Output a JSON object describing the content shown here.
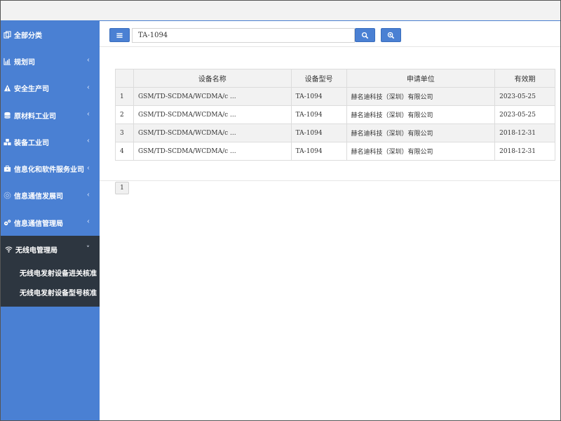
{
  "sidebar": {
    "items": [
      {
        "label": "全部分类",
        "icon": "copy-icon",
        "has_chevron": false
      },
      {
        "label": "规划司",
        "icon": "bar-chart-icon",
        "has_chevron": true
      },
      {
        "label": "安全生产司",
        "icon": "warning-icon",
        "has_chevron": true
      },
      {
        "label": "原材料工业司",
        "icon": "database-icon",
        "has_chevron": true
      },
      {
        "label": "装备工业司",
        "icon": "cubes-icon",
        "has_chevron": true
      },
      {
        "label": "信息化和软件服务业司",
        "icon": "briefcase-icon",
        "has_chevron": true
      },
      {
        "label": "信息通信发展司",
        "icon": "globe-icon",
        "has_chevron": true
      },
      {
        "label": "信息通信管理局",
        "icon": "cogs-icon",
        "has_chevron": true
      }
    ],
    "open_item": {
      "label": "无线电管理局",
      "icon": "wifi-icon",
      "chevron": "˅",
      "sub_items": [
        "无线电发射设备进关核准",
        "无线电发射设备型号核准"
      ]
    },
    "chevron": "‹"
  },
  "search": {
    "value": "TA-1094",
    "menu_icon": "bars-icon",
    "search_icon": "search-icon",
    "zoom_icon": "zoom-in-icon"
  },
  "table": {
    "headers": [
      "",
      "设备名称",
      "设备型号",
      "申请单位",
      "有效期"
    ],
    "rows": [
      {
        "index": "1",
        "name": "GSM/TD-SCDMA/WCDMA/c ...",
        "model": "TA-1094",
        "company": "赫名迪科技（深圳）有限公司",
        "expiry": "2023-05-25"
      },
      {
        "index": "2",
        "name": "GSM/TD-SCDMA/WCDMA/c ...",
        "model": "TA-1094",
        "company": "赫名迪科技（深圳）有限公司",
        "expiry": "2023-05-25"
      },
      {
        "index": "3",
        "name": "GSM/TD-SCDMA/WCDMA/c ...",
        "model": "TA-1094",
        "company": "赫名迪科技（深圳）有限公司",
        "expiry": "2018-12-31"
      },
      {
        "index": "4",
        "name": "GSM/TD-SCDMA/WCDMA/c ...",
        "model": "TA-1094",
        "company": "赫名迪科技（深圳）有限公司",
        "expiry": "2018-12-31"
      }
    ]
  },
  "pagination": {
    "current": "1"
  },
  "colors": {
    "sidebar": "#4a80d3",
    "sidebar_open": "#2d3640",
    "accent": "#4a80d3"
  }
}
